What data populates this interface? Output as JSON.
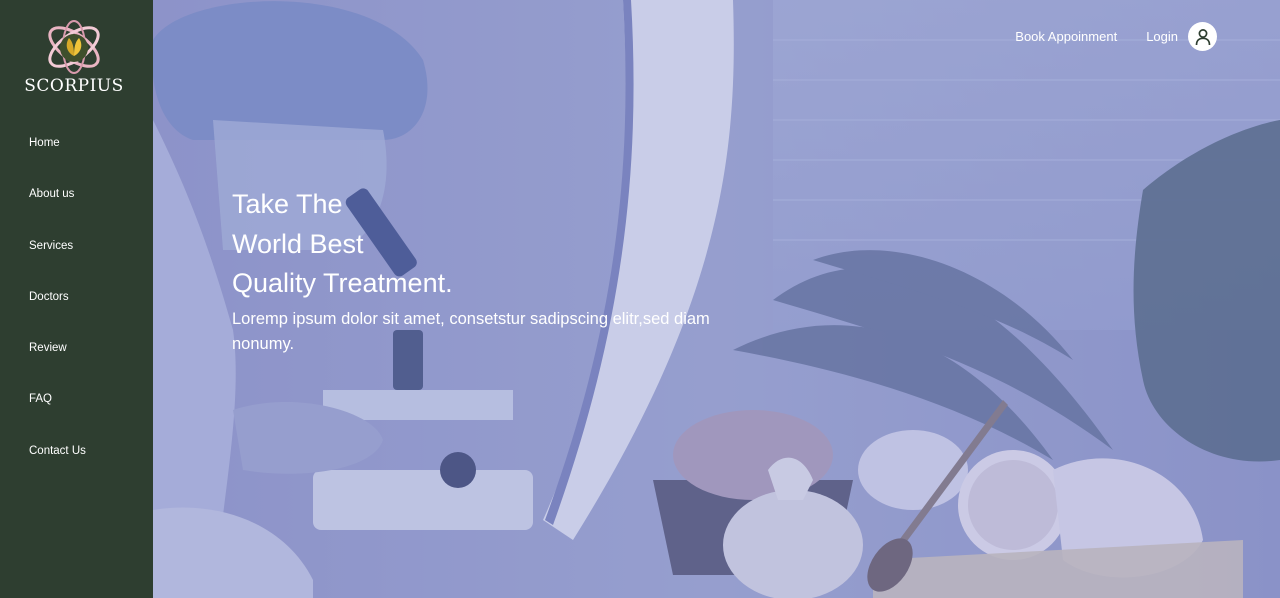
{
  "brand": {
    "name": "SCORPIUS",
    "logo_icon": "leaf-orbit-logo-icon"
  },
  "sidebar": {
    "items": [
      {
        "label": "Home"
      },
      {
        "label": "About us"
      },
      {
        "label": "Services"
      },
      {
        "label": "Doctors"
      },
      {
        "label": "Review"
      },
      {
        "label": "FAQ"
      },
      {
        "label": "Contact Us"
      }
    ]
  },
  "topnav": {
    "book_label": "Book Appoinment",
    "login_label": "Login",
    "avatar_icon": "user-icon"
  },
  "hero": {
    "headline": [
      "Take The",
      "World Best",
      "Quality Treatment."
    ],
    "subtext": "Loremp ipsum dolor sit amet, consetstur sadipscing elitr,sed diam nonumy.",
    "background": "laboratory-photo-with-microscope-and-spa-items"
  },
  "colors": {
    "sidebar_bg": "#2e3e30",
    "hero_overlay": "#8e96cc",
    "text": "#ffffff"
  }
}
